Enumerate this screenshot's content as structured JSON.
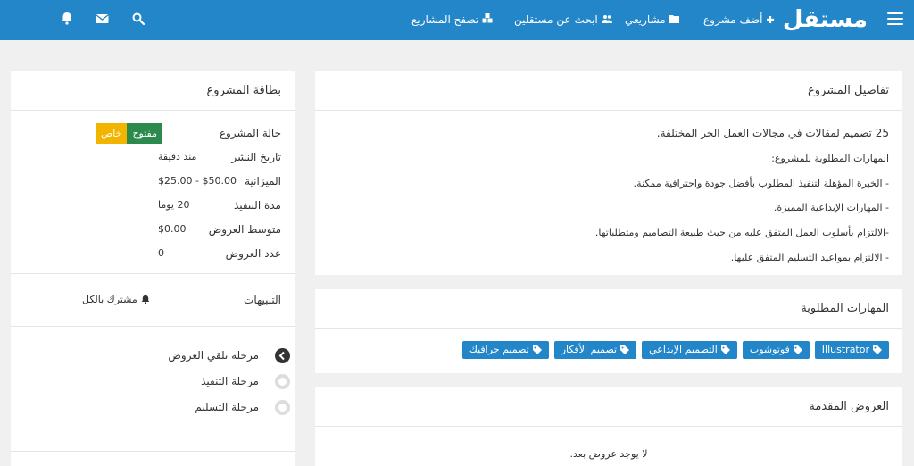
{
  "header": {
    "logo": "مستقل",
    "nav": [
      {
        "label": "أضف مشروع",
        "icon": "plus-icon"
      },
      {
        "label": "مشاريعي",
        "icon": "folder-icon"
      },
      {
        "label": "ابحث عن مستقلين",
        "icon": "users-icon"
      },
      {
        "label": "تصفح المشاريع",
        "icon": "cubes-icon"
      }
    ],
    "icons": [
      "search-icon",
      "envelope-icon",
      "bell-icon"
    ]
  },
  "project_details": {
    "title": "تفاصيل المشروع",
    "lines": [
      "25 تصميم لمقالات في مجالات العمل الحر المختلفة.",
      "المهارات المطلوبة للمشروع:",
      "- الخبرة المؤهلة لتنفيذ المطلوب بأفضل جودة واحترافية ممكنة.",
      "- المهارات الإبداعية المميزة.",
      "-الالتزام بأسلوب العمل المتفق عليه من حيث طبيعة التصاميم ومتطلباتها.",
      "- الالتزام بمواعيد التسليم المتفق عليها."
    ]
  },
  "skills": {
    "title": "المهارات المطلوبة",
    "items": [
      "Illustrator",
      "فوتوشوب",
      "التصميم الإبداعي",
      "تصميم الأفكار",
      "تصميم جرافيك"
    ]
  },
  "offers": {
    "title": "العروض المقدمة",
    "empty_text": "لا يوجد عروض بعد."
  },
  "project_card": {
    "title": "بطاقة المشروع",
    "status_label": "حالة المشروع",
    "status_badges": {
      "open": "مفتوح",
      "private": "خاص"
    },
    "rows": [
      {
        "label": "تاريخ النشر",
        "value": "منذ دقيقة"
      },
      {
        "label": "الميزانية",
        "value": "$25.00 - $50.00"
      },
      {
        "label": "مدة التنفيذ",
        "value": "20 يوما"
      },
      {
        "label": "متوسط العروض",
        "value": "$0.00"
      },
      {
        "label": "عدد العروض",
        "value": "0"
      }
    ],
    "notifications_label": "التنبيهات",
    "notifications_value": "مشترك بالكل",
    "stages": [
      {
        "label": "مرحلة تلقي العروض",
        "active": true
      },
      {
        "label": "مرحلة التنفيذ",
        "active": false
      },
      {
        "label": "مرحلة التسليم",
        "active": false
      }
    ]
  },
  "colors": {
    "primary": "#2386c8",
    "open": "#2d8a4e",
    "private": "#f3b400"
  }
}
